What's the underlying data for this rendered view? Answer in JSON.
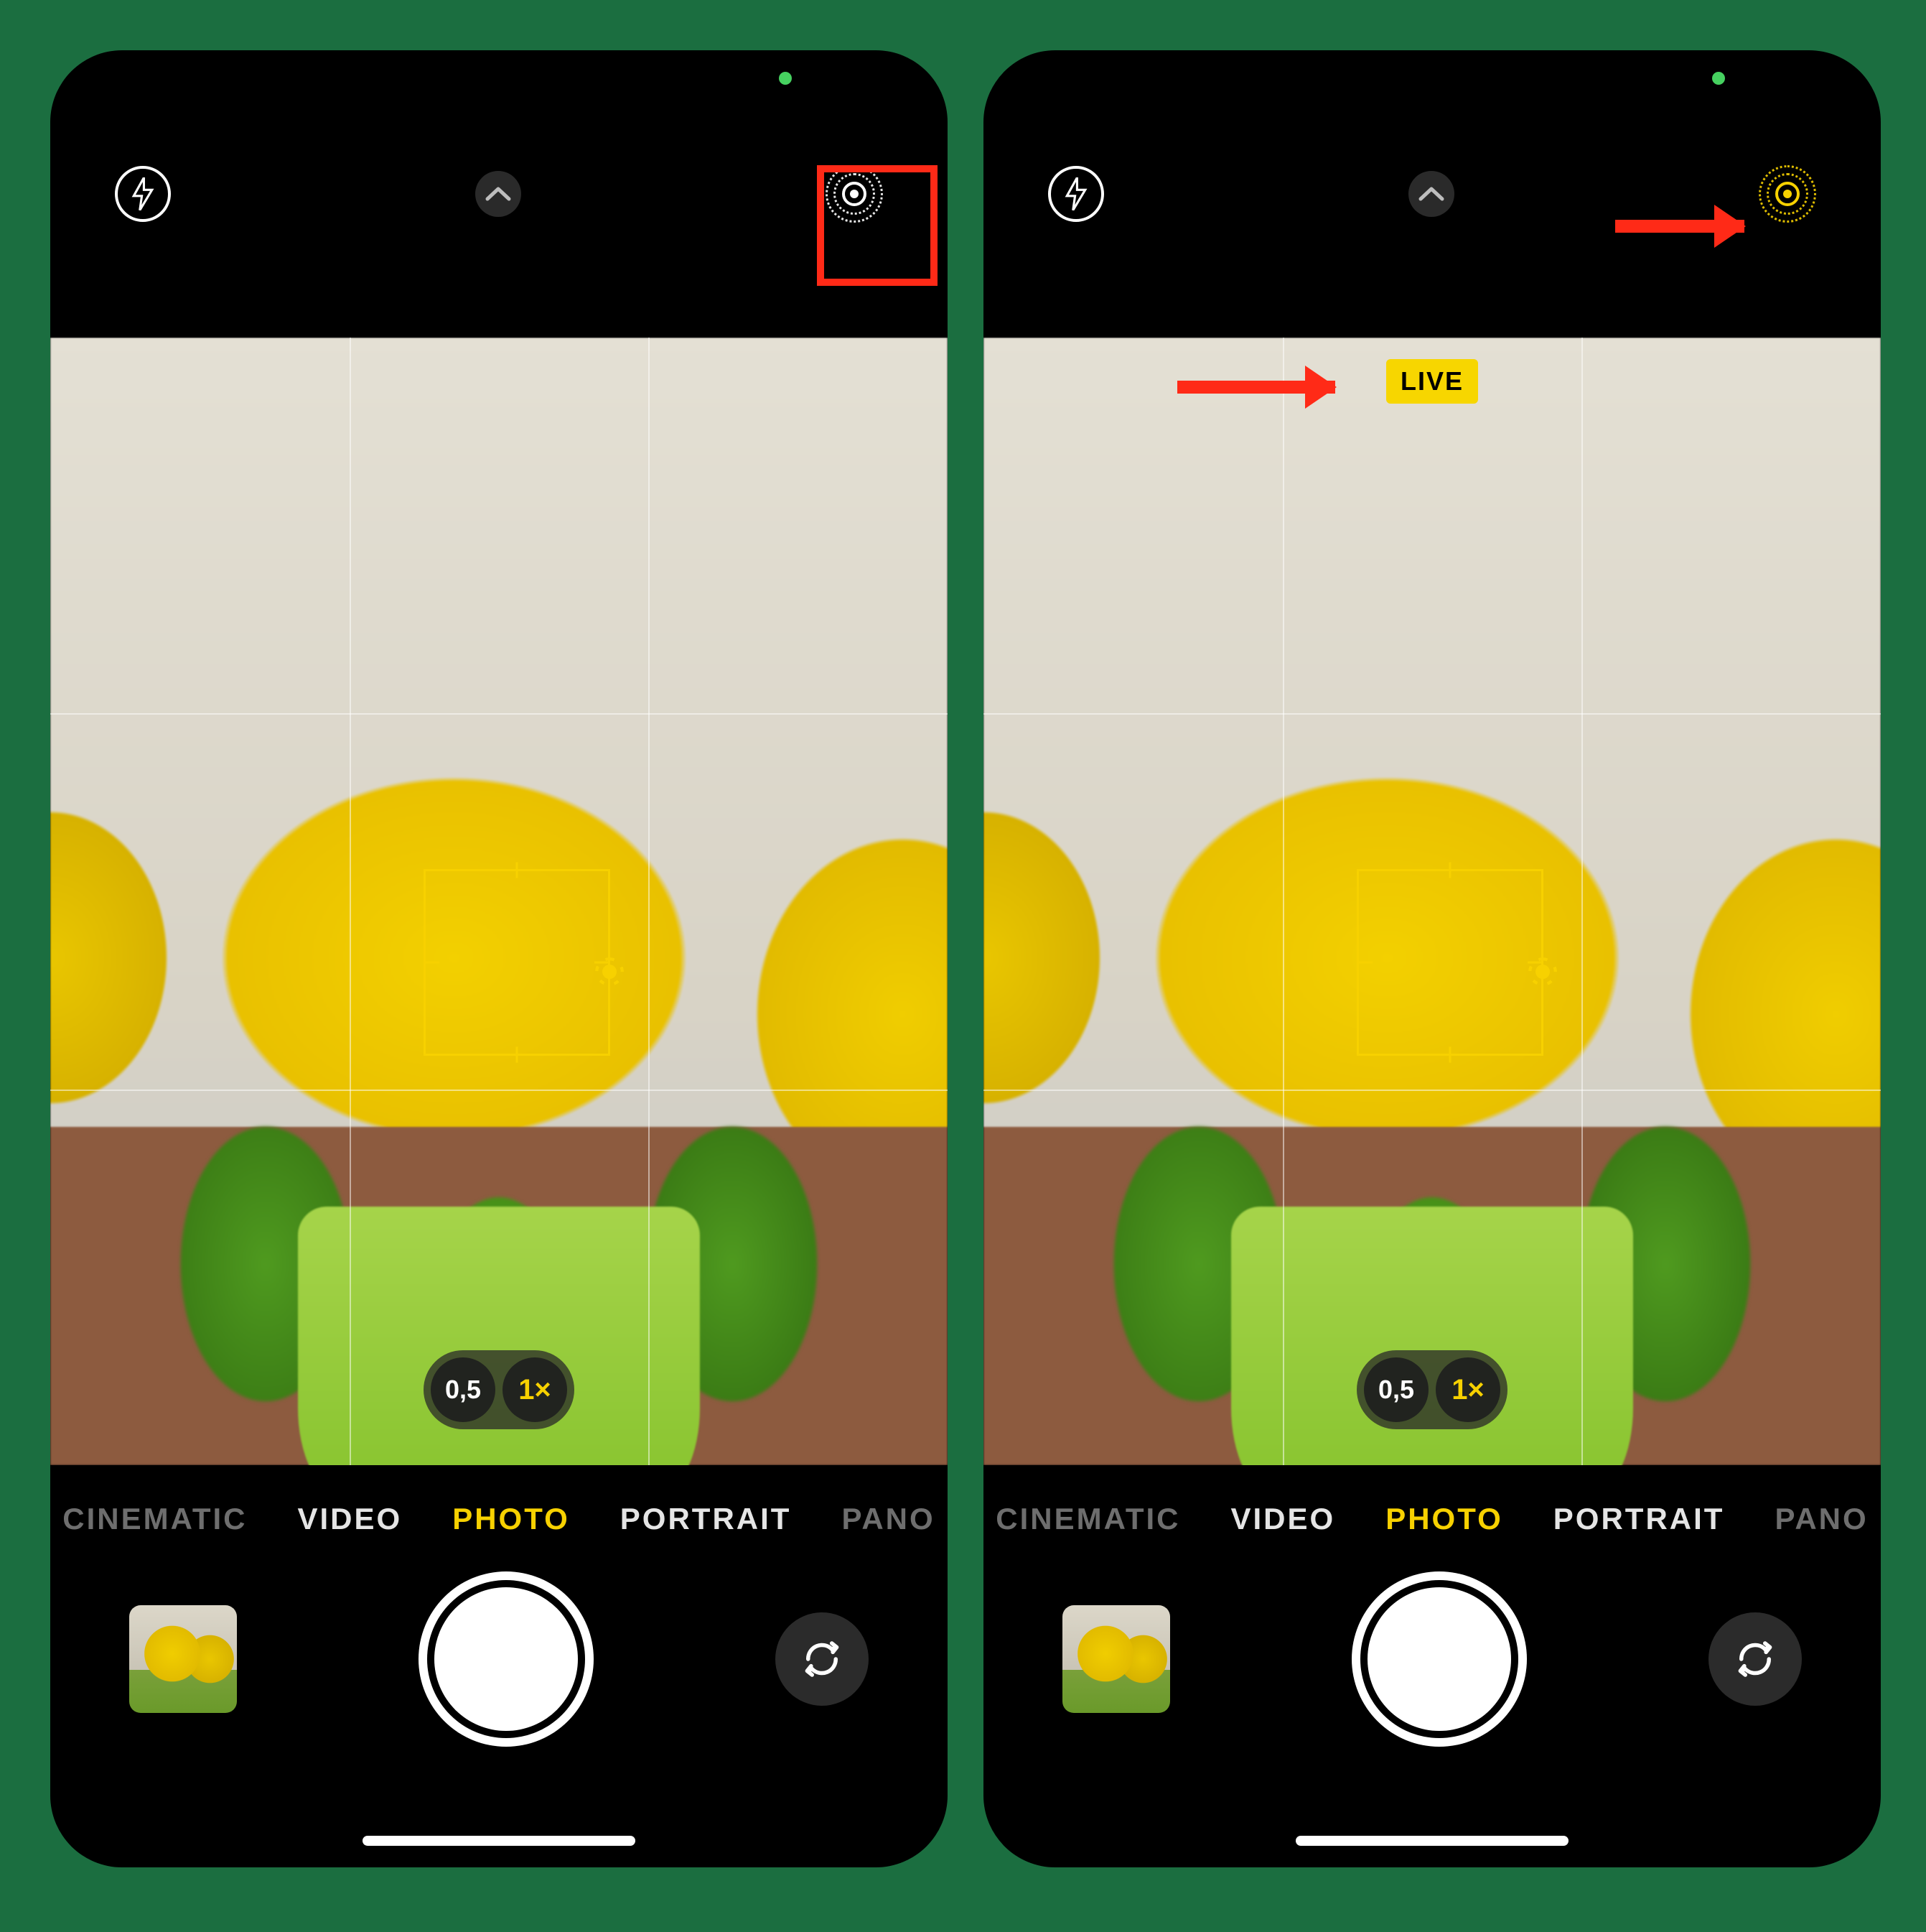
{
  "colors": {
    "accent": "#f7d100"
  },
  "topbar": {
    "flash_icon": "flash-icon",
    "chevron_icon": "chevron-up-icon",
    "live_icon_off": "live-photo-off-icon",
    "live_icon_on": "live-photo-on-icon"
  },
  "live_badge": "LIVE",
  "zoom": {
    "wide": "0,5",
    "main": "1×",
    "selected": "1×"
  },
  "modes": [
    "CINEMATIC",
    "VIDEO",
    "PHOTO",
    "PORTRAIT",
    "PANO"
  ],
  "selected_mode": "PHOTO",
  "bottom": {
    "thumbnail_icon": "last-photo-thumbnail",
    "shutter_icon": "shutter-button",
    "flip_icon": "flip-camera-icon"
  },
  "annotations": {
    "left": {
      "highlight_box": "live-photo-toggle"
    },
    "right": {
      "arrow_to_toggle": "live-photo-toggle",
      "arrow_to_badge": "live-badge"
    }
  }
}
